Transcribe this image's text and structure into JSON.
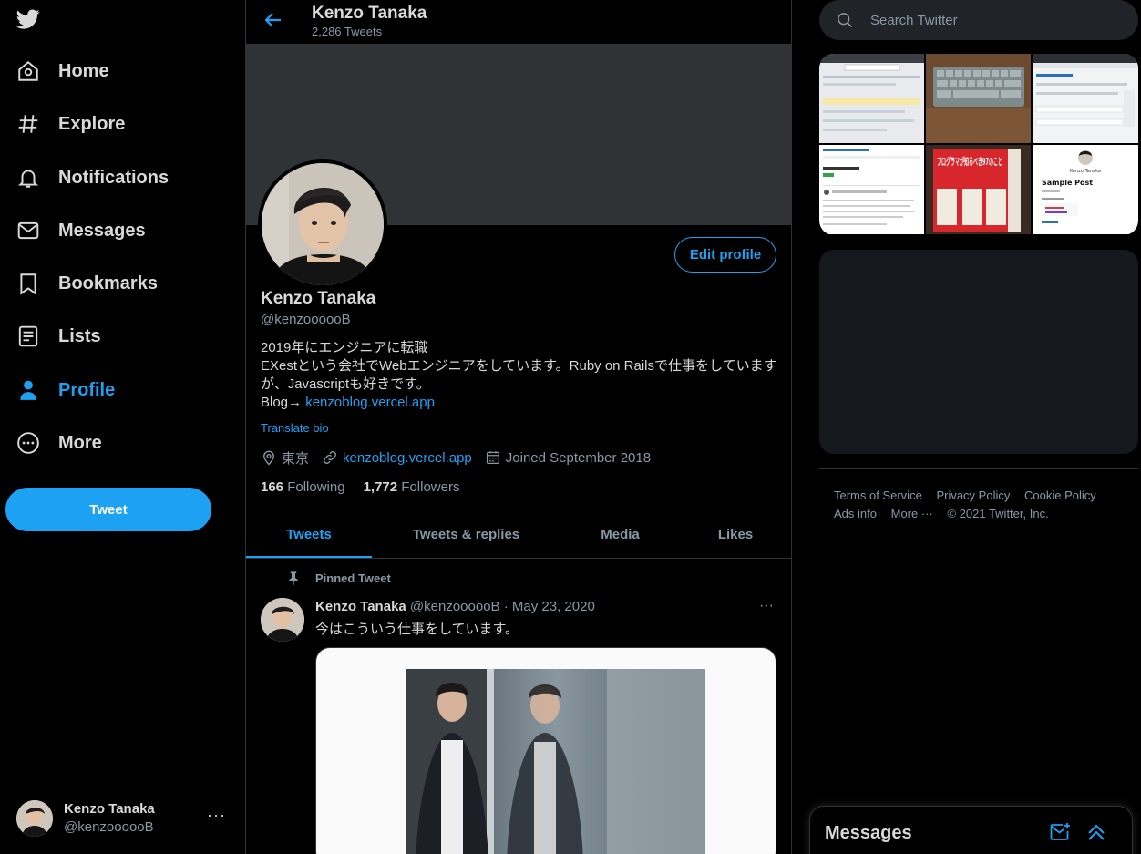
{
  "nav": {
    "items": [
      {
        "label": "Home",
        "icon": "home-icon"
      },
      {
        "label": "Explore",
        "icon": "hashtag-icon"
      },
      {
        "label": "Notifications",
        "icon": "bell-icon"
      },
      {
        "label": "Messages",
        "icon": "envelope-icon"
      },
      {
        "label": "Bookmarks",
        "icon": "bookmark-icon"
      },
      {
        "label": "Lists",
        "icon": "list-icon"
      },
      {
        "label": "Profile",
        "icon": "person-icon"
      },
      {
        "label": "More",
        "icon": "more-circle-icon"
      }
    ],
    "active": "Profile",
    "tweet_button": "Tweet"
  },
  "account": {
    "name": "Kenzo Tanaka",
    "handle": "@kenzoooooB",
    "menu": "···"
  },
  "header": {
    "name": "Kenzo Tanaka",
    "tweet_count": "2,286 Tweets"
  },
  "profile": {
    "edit_button": "Edit profile",
    "name": "Kenzo Tanaka",
    "handle": "@kenzoooooB",
    "bio_line1": "2019年にエンジニアに転職",
    "bio_line2": "EXestという会社でWebエンジニアをしています。Ruby on Railsで仕事をしていますが、Javascriptも好きです。",
    "bio_blog_prefix": "Blog→ ",
    "bio_blog_link": "kenzoblog.vercel.app",
    "translate": "Translate bio",
    "location": "東京",
    "website": "kenzoblog.vercel.app",
    "joined": "Joined September 2018",
    "following_count": "166",
    "following_label": "Following",
    "followers_count": "1,772",
    "followers_label": "Followers"
  },
  "tabs": [
    {
      "label": "Tweets",
      "active": true
    },
    {
      "label": "Tweets & replies",
      "active": false
    },
    {
      "label": "Media",
      "active": false
    },
    {
      "label": "Likes",
      "active": false
    }
  ],
  "pinned_tweet": {
    "pinned_label": "Pinned Tweet",
    "name": "Kenzo Tanaka",
    "handle": "@kenzoooooB",
    "date": "· May 23, 2020",
    "text": "今はこういう仕事をしています。",
    "menu": "···"
  },
  "search": {
    "placeholder": "Search Twitter"
  },
  "media_grid": {
    "thumb_5_title": "プログラマが知るべき97のこと",
    "thumb_6_title": "Sample Post",
    "thumb_6_caption": "Kenzo Tanaka"
  },
  "footer": {
    "links": [
      "Terms of Service",
      "Privacy Policy",
      "Cookie Policy",
      "Ads info",
      "More ···",
      "© 2021 Twitter, Inc."
    ]
  },
  "messages_dock": {
    "title": "Messages"
  },
  "colors": {
    "accent": "#1da1f2",
    "background": "#000000",
    "muted": "#8899a6",
    "border": "#2f3336"
  }
}
